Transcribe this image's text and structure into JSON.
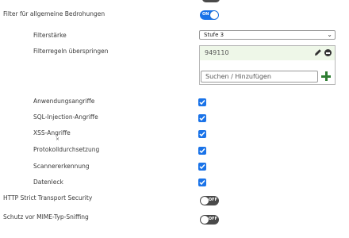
{
  "settings": {
    "general_filter": {
      "label": "Filter für allgemeine Bedrohungen",
      "state": "ON"
    },
    "filter_strength": {
      "label": "Filterstärke",
      "selected": "Stufe 3"
    },
    "skip_rules": {
      "label": "Filterregeln überspringen",
      "items": [
        "949110"
      ],
      "search_placeholder": "Suchen / Hinzufügen"
    },
    "checks": [
      {
        "label": "Anwendungsangriffe",
        "checked": true
      },
      {
        "label": "SQL-Injection-Angriffe",
        "checked": true
      },
      {
        "label": "XSS-Angriffe",
        "checked": true
      },
      {
        "label": "Protokolldurchsetzung",
        "checked": true
      },
      {
        "label": "Scannererkennung",
        "checked": true
      },
      {
        "label": "Datenleck",
        "checked": true
      }
    ],
    "hsts": {
      "label": "HTTP Strict Transport Security",
      "state": "OFF"
    },
    "mime_sniff": {
      "label": "Schutz vor MIME-Typ-Sniffing",
      "state": "OFF"
    }
  },
  "colors": {
    "accent": "#1a73e8",
    "toggle_off": "#4a4a4a",
    "add": "#2e7d32",
    "row_highlight": "#eef7e8"
  }
}
